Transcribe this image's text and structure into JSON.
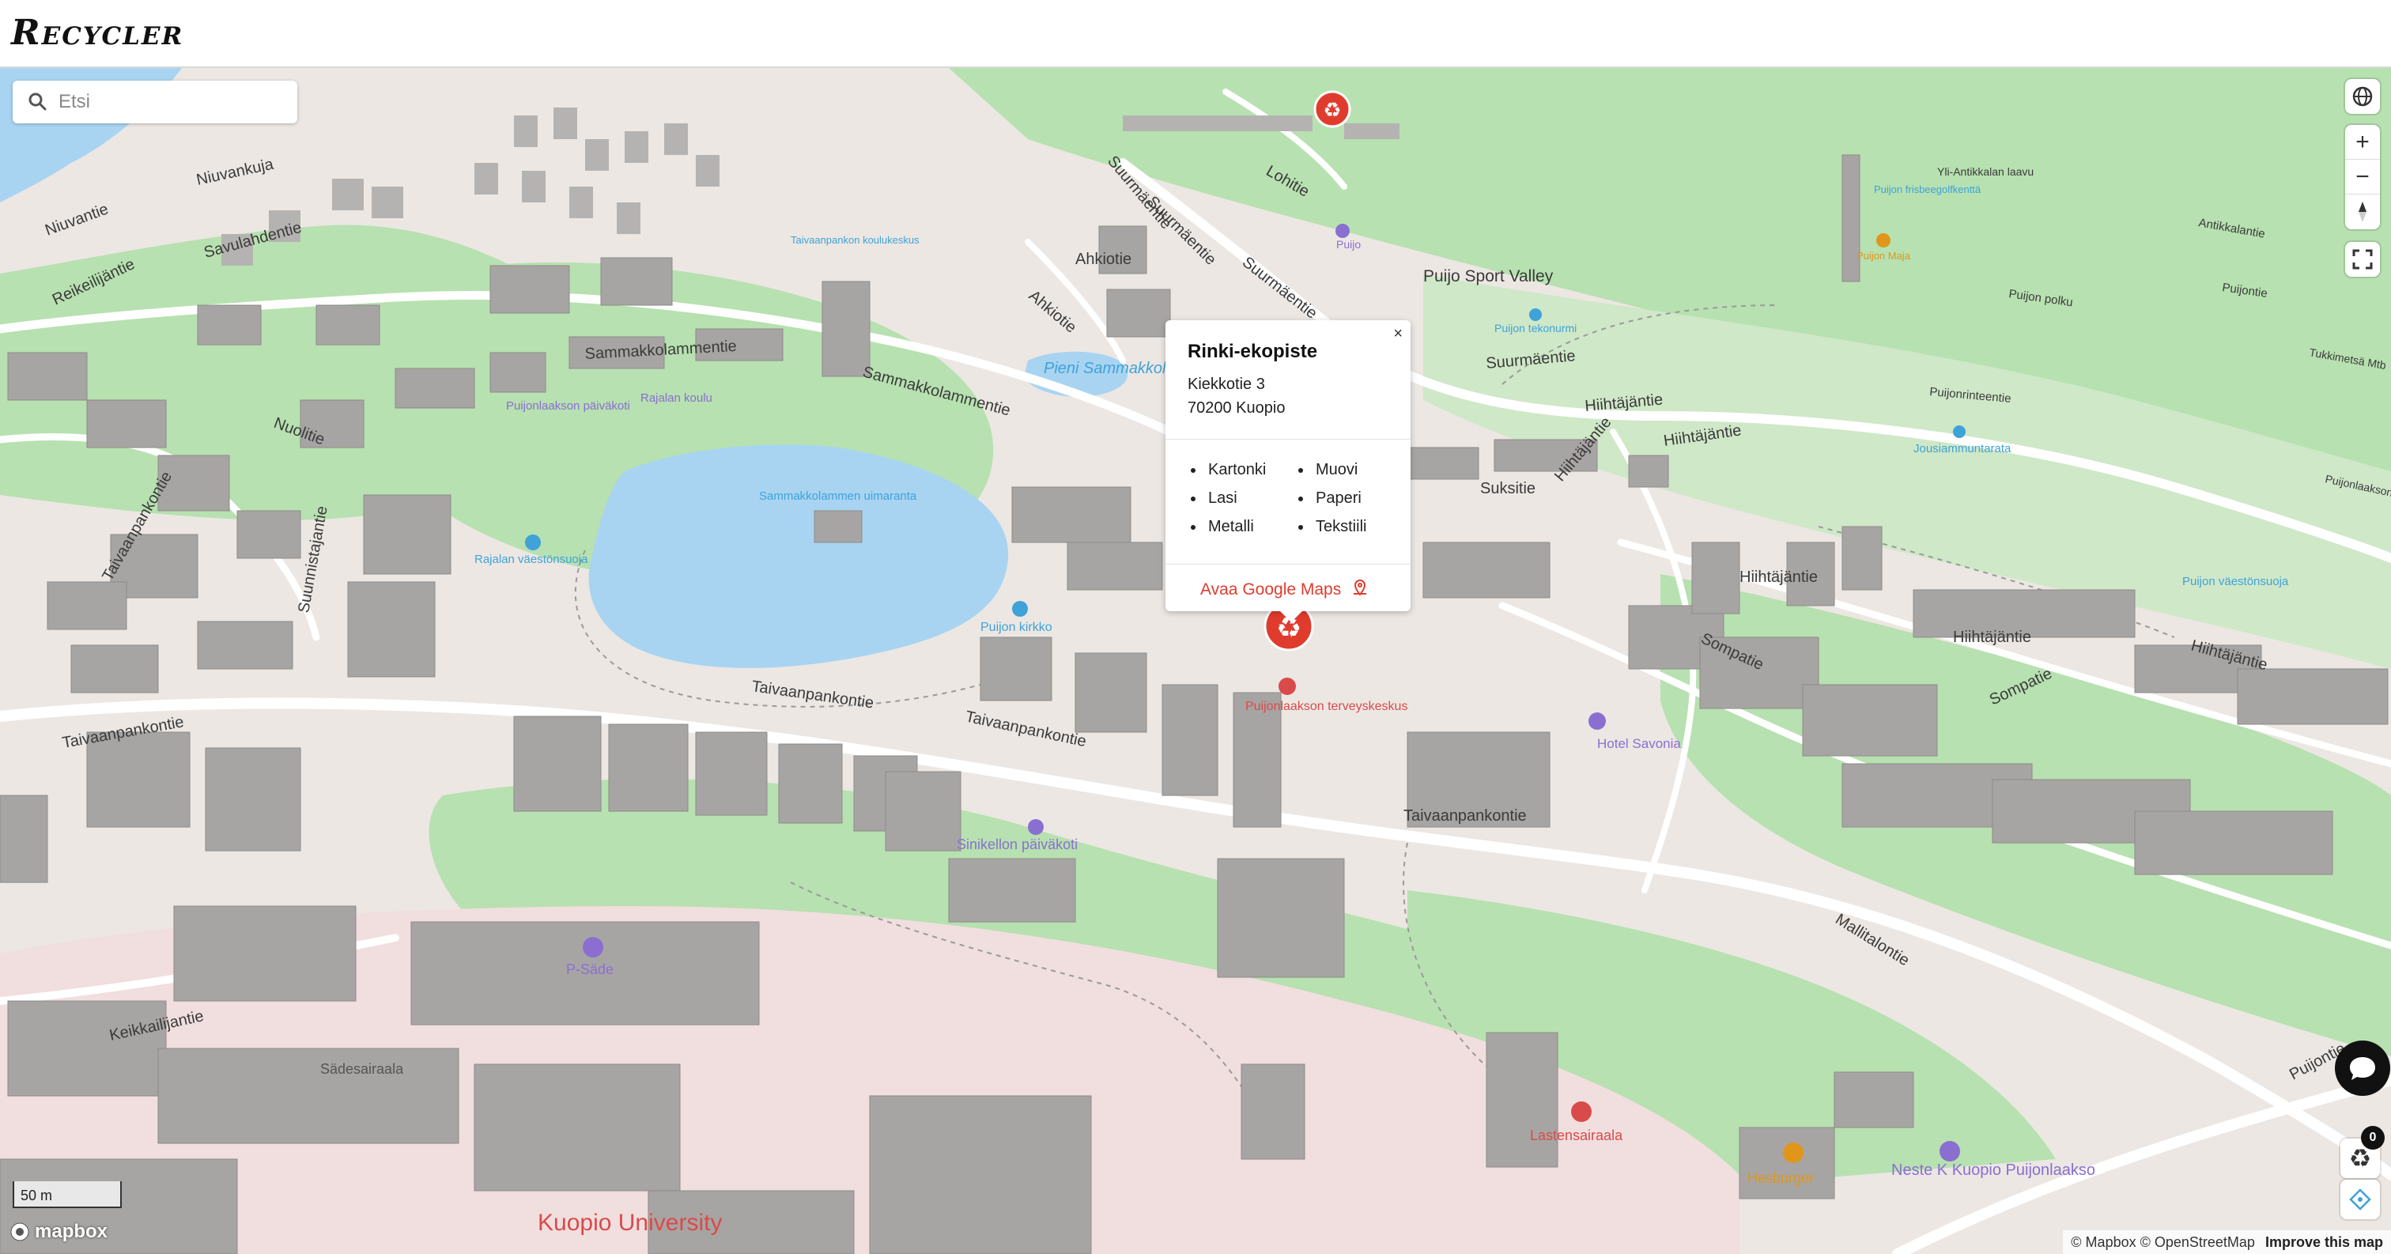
{
  "app": {
    "title": "Recycler"
  },
  "search": {
    "placeholder": "Etsi",
    "value": ""
  },
  "popup": {
    "title": "Rinki-ekopiste",
    "address_line1": "Kiekkotie 3",
    "address_line2": "70200 Kuopio",
    "materials": [
      "Kartonki",
      "Muovi",
      "Lasi",
      "Paperi",
      "Metalli",
      "Tekstiili"
    ],
    "google_maps_label": "Avaa Google Maps",
    "close_label": "×"
  },
  "map": {
    "street_labels": [
      "Niuvankuja",
      "Niuvantie",
      "Savulahdentie",
      "Reikeilijäntie",
      "Sammakkolammentie",
      "Sammakkolammentie",
      "Nuolitie",
      "Taivaanpankontie",
      "Suunnistajantie",
      "Taivaanpankontie",
      "Taivaanpankontie",
      "Taivaanpankontie",
      "Taivaanpankontie",
      "Suurmäentie",
      "Suurmäentie",
      "Suurmäentie",
      "Suurmäentie",
      "Ahkiotie",
      "Ahkiotie",
      "Lohitie",
      "Suksitie",
      "Hiihtäjäntie",
      "Hiihtäjäntie",
      "Hiihtäjäntie",
      "Hiihtäjäntie",
      "Hiihtäjäntie",
      "Hiihtäjäntie",
      "Sompatie",
      "Sompatie",
      "Mallitalontie",
      "Keikkailijantie",
      "Puijontie",
      "Puijonrinteentie",
      "Antikkalantie",
      "Yli-Antikkalan laavu",
      "Puijon polku",
      "Tukkimetsä Mtb",
      "Puijontie",
      "Puijonlaaksontie",
      "Puijon frisbeegolfkenttä"
    ],
    "place_labels": [
      "Puijo Sport Valley",
      "Pieni Sammakkolampi",
      "Sammakkolammen uimaranta",
      "Puijonlaakson päiväkoti",
      "Rajalan koulu",
      "Rajalan väestönsuoja",
      "Puijon kirkko",
      "Puijonlaakson terveyskeskus",
      "Sinikellon päiväkoti",
      "P-Säde",
      "Sädesairaala",
      "Kuopio University",
      "Lastensairaala",
      "Hesburger",
      "Neste K Kuopio Puijonlaakso",
      "Hotel Savonia",
      "Puijon tekonurmi",
      "Jousiammuntarata",
      "Puijon väestönsuoja",
      "Taivaanpankon koulukeskus",
      "Puijon Maja",
      "Puijo"
    ],
    "scale_label": "50 m",
    "attribution": "© Mapbox © OpenStreetMap",
    "improve_label": "Improve this map",
    "logo_label": "mapbox"
  },
  "controls": {
    "globe_icon": "globe-icon",
    "zoom_in_label": "+",
    "zoom_out_label": "−",
    "compass_icon": "compass-icon",
    "fullscreen_icon": "fullscreen-icon",
    "chat_icon": "chat-icon",
    "recycle_count": "0",
    "locate_icon": "locate-icon"
  },
  "colors": {
    "park": "#b7e1b0",
    "water": "#a8d4f2",
    "land": "#ece7e3",
    "building": "#a7a5a3",
    "hospital_area": "#f1dede",
    "marker": "#e03c2e",
    "poi_purple": "#8a6fd1",
    "poi_blue": "#3fa2d8",
    "poi_red": "#d94b4b",
    "poi_orange": "#e0961b"
  }
}
